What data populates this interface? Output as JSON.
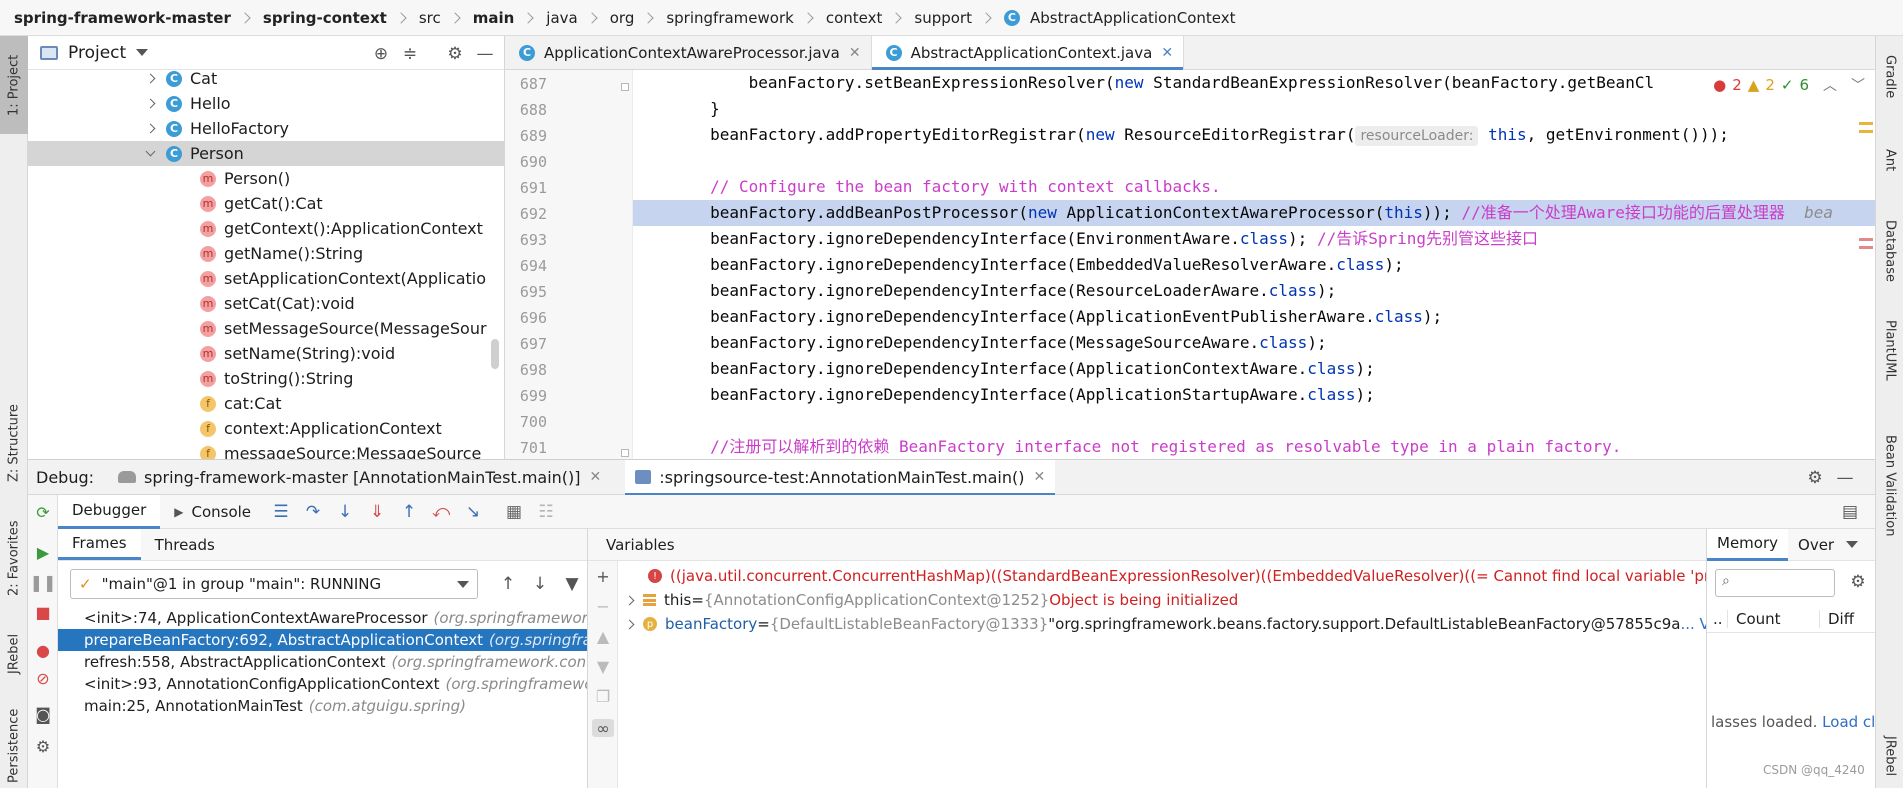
{
  "breadcrumb": [
    {
      "label": "spring-framework-master",
      "bold": true
    },
    {
      "label": "spring-context",
      "bold": true
    },
    {
      "label": "src",
      "bold": false
    },
    {
      "label": "main",
      "bold": true
    },
    {
      "label": "java",
      "bold": false
    },
    {
      "label": "org",
      "bold": false
    },
    {
      "label": "springframework",
      "bold": false
    },
    {
      "label": "context",
      "bold": false
    },
    {
      "label": "support",
      "bold": false
    },
    {
      "label": "AbstractApplicationContext",
      "bold": false,
      "icon": "class-icon"
    }
  ],
  "left_strip": {
    "project_tab": "1: Project",
    "structure_tab": "Z: Structure",
    "favorites_tab": "2: Favorites",
    "jrebel_tab": "JRebel",
    "persistence_tab": "Persistence"
  },
  "right_strip": {
    "gradle_tab": "Gradle",
    "ant_tab": "Ant",
    "database_tab": "Database",
    "plantuml_tab": "PlantUML",
    "bean_validation_tab": "Bean Validation",
    "jrebel_tab": "JRebel"
  },
  "project": {
    "title": "Project",
    "tree": [
      {
        "label": "Cat",
        "type": "class",
        "expand": "collapsed"
      },
      {
        "label": "Hello",
        "type": "class",
        "expand": "collapsed"
      },
      {
        "label": "HelloFactory",
        "type": "class",
        "expand": "collapsed"
      },
      {
        "label": "Person",
        "type": "class",
        "expand": "expanded",
        "selected": true
      },
      {
        "label": "Person()",
        "type": "method"
      },
      {
        "label": "getCat():Cat",
        "type": "method"
      },
      {
        "label": "getContext():ApplicationContext",
        "type": "method"
      },
      {
        "label": "getName():String",
        "type": "method"
      },
      {
        "label": "setApplicationContext(Applicatio",
        "type": "method"
      },
      {
        "label": "setCat(Cat):void",
        "type": "method"
      },
      {
        "label": "setMessageSource(MessageSour",
        "type": "method"
      },
      {
        "label": "setName(String):void",
        "type": "method"
      },
      {
        "label": "toString():String",
        "type": "method"
      },
      {
        "label": "cat:Cat",
        "type": "field"
      },
      {
        "label": "context:ApplicationContext",
        "type": "field"
      },
      {
        "label": "messageSource:MessageSource",
        "type": "field"
      }
    ]
  },
  "editor": {
    "tabs": [
      {
        "label": "ApplicationContextAwareProcessor.java",
        "active": false
      },
      {
        "label": "AbstractApplicationContext.java",
        "active": true
      }
    ],
    "inspections": {
      "errors": "2",
      "warnings": "2",
      "ok": "6"
    },
    "line_numbers": [
      "687",
      "688",
      "689",
      "690",
      "691",
      "692",
      "693",
      "694",
      "695",
      "696",
      "697",
      "698",
      "699",
      "700",
      "701"
    ],
    "code": {
      "l687_a": "            beanFactory.setBeanExpressionResolver(",
      "l687_kw": "new",
      "l687_b": " StandardBeanExpressionResolver(beanFactory.getBeanCl",
      "l688": "        }",
      "l689_a": "        beanFactory.addPropertyEditorRegistrar(",
      "l689_kw": "new",
      "l689_b": " ResourceEditorRegistrar(",
      "l689_hint": "resourceLoader:",
      "l689_kw2": "this",
      "l689_c": ", getEnvironment()));",
      "l691": "        // Configure the bean factory with context callbacks.",
      "l692_a": "        beanFactory.addBeanPostProcessor(",
      "l692_kw": "new",
      "l692_b": " ApplicationContextAwareProcessor(",
      "l692_kw2": "this",
      "l692_c": ")); ",
      "l692_cmt": "//准备一个处理Aware接口功能的后置处理器",
      "l692_tail": "  bea",
      "ignore_prefix": "        beanFactory.ignoreDependencyInterface(",
      "class_kw": "class",
      "ignore_suffix": ");",
      "l693_iface": "EnvironmentAware.",
      "l693_cmt": " //告诉Spring先别管这些接口",
      "l694_iface": "EmbeddedValueResolverAware.",
      "l695_iface": "ResourceLoaderAware.",
      "l696_iface": "ApplicationEventPublisherAware.",
      "l697_iface": "MessageSourceAware.",
      "l698_iface": "ApplicationContextAware.",
      "l699_iface": "ApplicationStartupAware.",
      "l701": "        //注册可以解析到的依赖 BeanFactory interface not registered as resolvable type in a plain factory."
    }
  },
  "debug": {
    "label": "Debug:",
    "sessions": [
      {
        "label": "spring-framework-master [AnnotationMainTest.main()]",
        "active": false
      },
      {
        "label": ":springsource-test:AnnotationMainTest.main()",
        "active": true
      }
    ],
    "toolbar_tabs": {
      "debugger": "Debugger",
      "console": "Console"
    },
    "frames_tab": "Frames",
    "threads_tab": "Threads",
    "thread_select": "\"main\"@1 in group \"main\": RUNNING",
    "frames": [
      {
        "method": "<init>:74, ApplicationContextAwareProcessor",
        "pkg": "(org.springframework.c"
      },
      {
        "method": "prepareBeanFactory:692, AbstractApplicationContext",
        "pkg": "(org.springfran",
        "selected": true
      },
      {
        "method": "refresh:558, AbstractApplicationContext",
        "pkg": "(org.springframework.conte"
      },
      {
        "method": "<init>:93, AnnotationConfigApplicationContext",
        "pkg": "(org.springframewor"
      },
      {
        "method": "main:25, AnnotationMainTest",
        "pkg": "(com.atguigu.spring)"
      }
    ],
    "variables_title": "Variables",
    "variables": {
      "err_expr": "((java.util.concurrent.ConcurrentHashMap)((StandardBeanExpressionResolver)((EmbeddedValueResolver)((",
      "err_msg": " = Cannot find local variable 'proces",
      "this_name": "this",
      "this_eq": " = ",
      "this_val": "{AnnotationConfigApplicationContext@1252}",
      "this_msg": " Object is being initialized",
      "bf_name": "beanFactory",
      "bf_eq": " = ",
      "bf_val": "{DefaultListableBeanFactory@1333}",
      "bf_str": " \"org.springframework.beans.factory.support.DefaultListableBeanFactory@57855c9a",
      "bf_more": "... View"
    },
    "memory": {
      "memory_tab": "Memory",
      "overhead_tab": "Over",
      "col_class": "..",
      "col_count": "Count",
      "col_diff": "Diff",
      "note_text": "lasses loaded.",
      "note_link": "Load cla"
    }
  },
  "watermark": "CSDN @qq_4240"
}
